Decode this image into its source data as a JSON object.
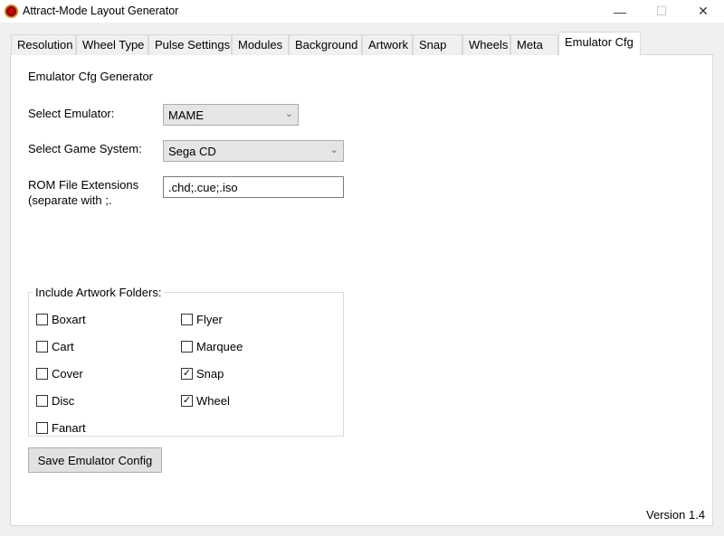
{
  "window": {
    "title": "Attract-Mode Layout Generator",
    "minimize": "—",
    "maximize": "☐",
    "close": "✕"
  },
  "tabs": [
    "Resolution",
    "Wheel Type",
    "Pulse Settings",
    "Modules",
    "Background",
    "Artwork",
    "Snap",
    "Wheels",
    "Meta",
    "Emulator Cfg"
  ],
  "selected_tab": "Emulator Cfg",
  "main": {
    "heading": "Emulator Cfg Generator",
    "emulator_label": "Select Emulator:",
    "emulator_value": "MAME",
    "system_label": "Select Game System:",
    "system_value": "Sega CD",
    "ext_label_1": "ROM File Extensions",
    "ext_label_2": "(separate with ;.",
    "ext_value": ".chd;.cue;.iso",
    "group_label": "Include Artwork Folders:",
    "checkboxes": [
      {
        "label": "Boxart",
        "checked": false
      },
      {
        "label": "Flyer",
        "checked": false
      },
      {
        "label": "Cart",
        "checked": false
      },
      {
        "label": "Marquee",
        "checked": false
      },
      {
        "label": "Cover",
        "checked": false
      },
      {
        "label": "Snap",
        "checked": true
      },
      {
        "label": "Disc",
        "checked": false
      },
      {
        "label": "Wheel",
        "checked": true
      },
      {
        "label": "Fanart",
        "checked": false
      }
    ],
    "save_label": "Save Emulator Config",
    "version": "Version 1.4"
  }
}
